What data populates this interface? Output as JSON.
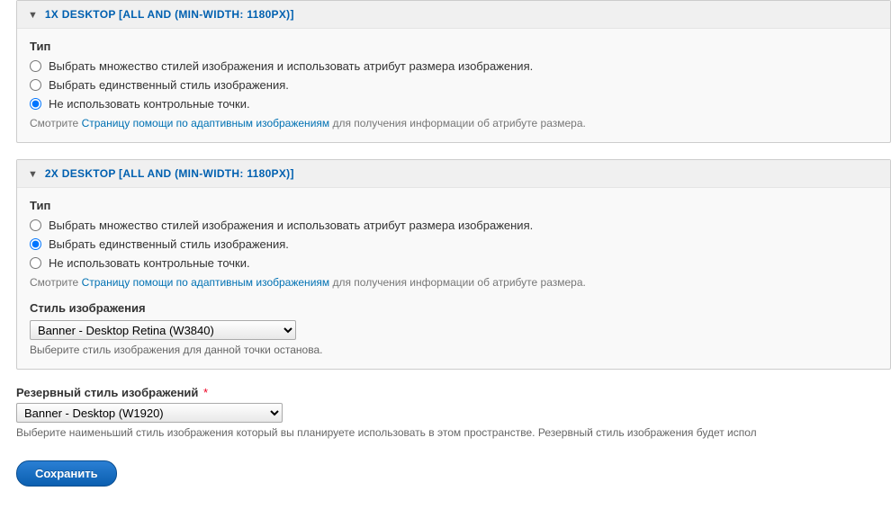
{
  "fieldset1": {
    "title": "1X DESKTOP [ALL AND (MIN-WIDTH: 1180PX)]",
    "type_label": "Тип",
    "radio1": "Выбрать множество стилей изображения и использовать атрибут размера изображения.",
    "radio2": "Выбрать единственный стиль изображения.",
    "radio3": "Не использовать контрольные точки.",
    "desc_prefix": "Смотрите ",
    "desc_link": "Страницу помощи по адаптивным изображениям",
    "desc_suffix": " для получения информации об атрибуте размера."
  },
  "fieldset2": {
    "title": "2X DESKTOP [ALL AND (MIN-WIDTH: 1180PX)]",
    "type_label": "Тип",
    "radio1": "Выбрать множество стилей изображения и использовать атрибут размера изображения.",
    "radio2": "Выбрать единственный стиль изображения.",
    "radio3": "Не использовать контрольные точки.",
    "desc_prefix": "Смотрите ",
    "desc_link": "Страницу помощи по адаптивным изображениям",
    "desc_suffix": " для получения информации об атрибуте размера.",
    "style_label": "Стиль изображения",
    "style_option": "Banner - Desktop Retina (W3840)",
    "style_help": "Выберите стиль изображения для данной точки останова."
  },
  "fallback": {
    "label": "Резервный стиль изображений",
    "option": "Banner - Desktop (W1920)",
    "help": "Выберите наименьший стиль изображения который вы планируете использовать в этом пространстве. Резервный стиль изображения будет испол"
  },
  "save_label": "Сохранить"
}
